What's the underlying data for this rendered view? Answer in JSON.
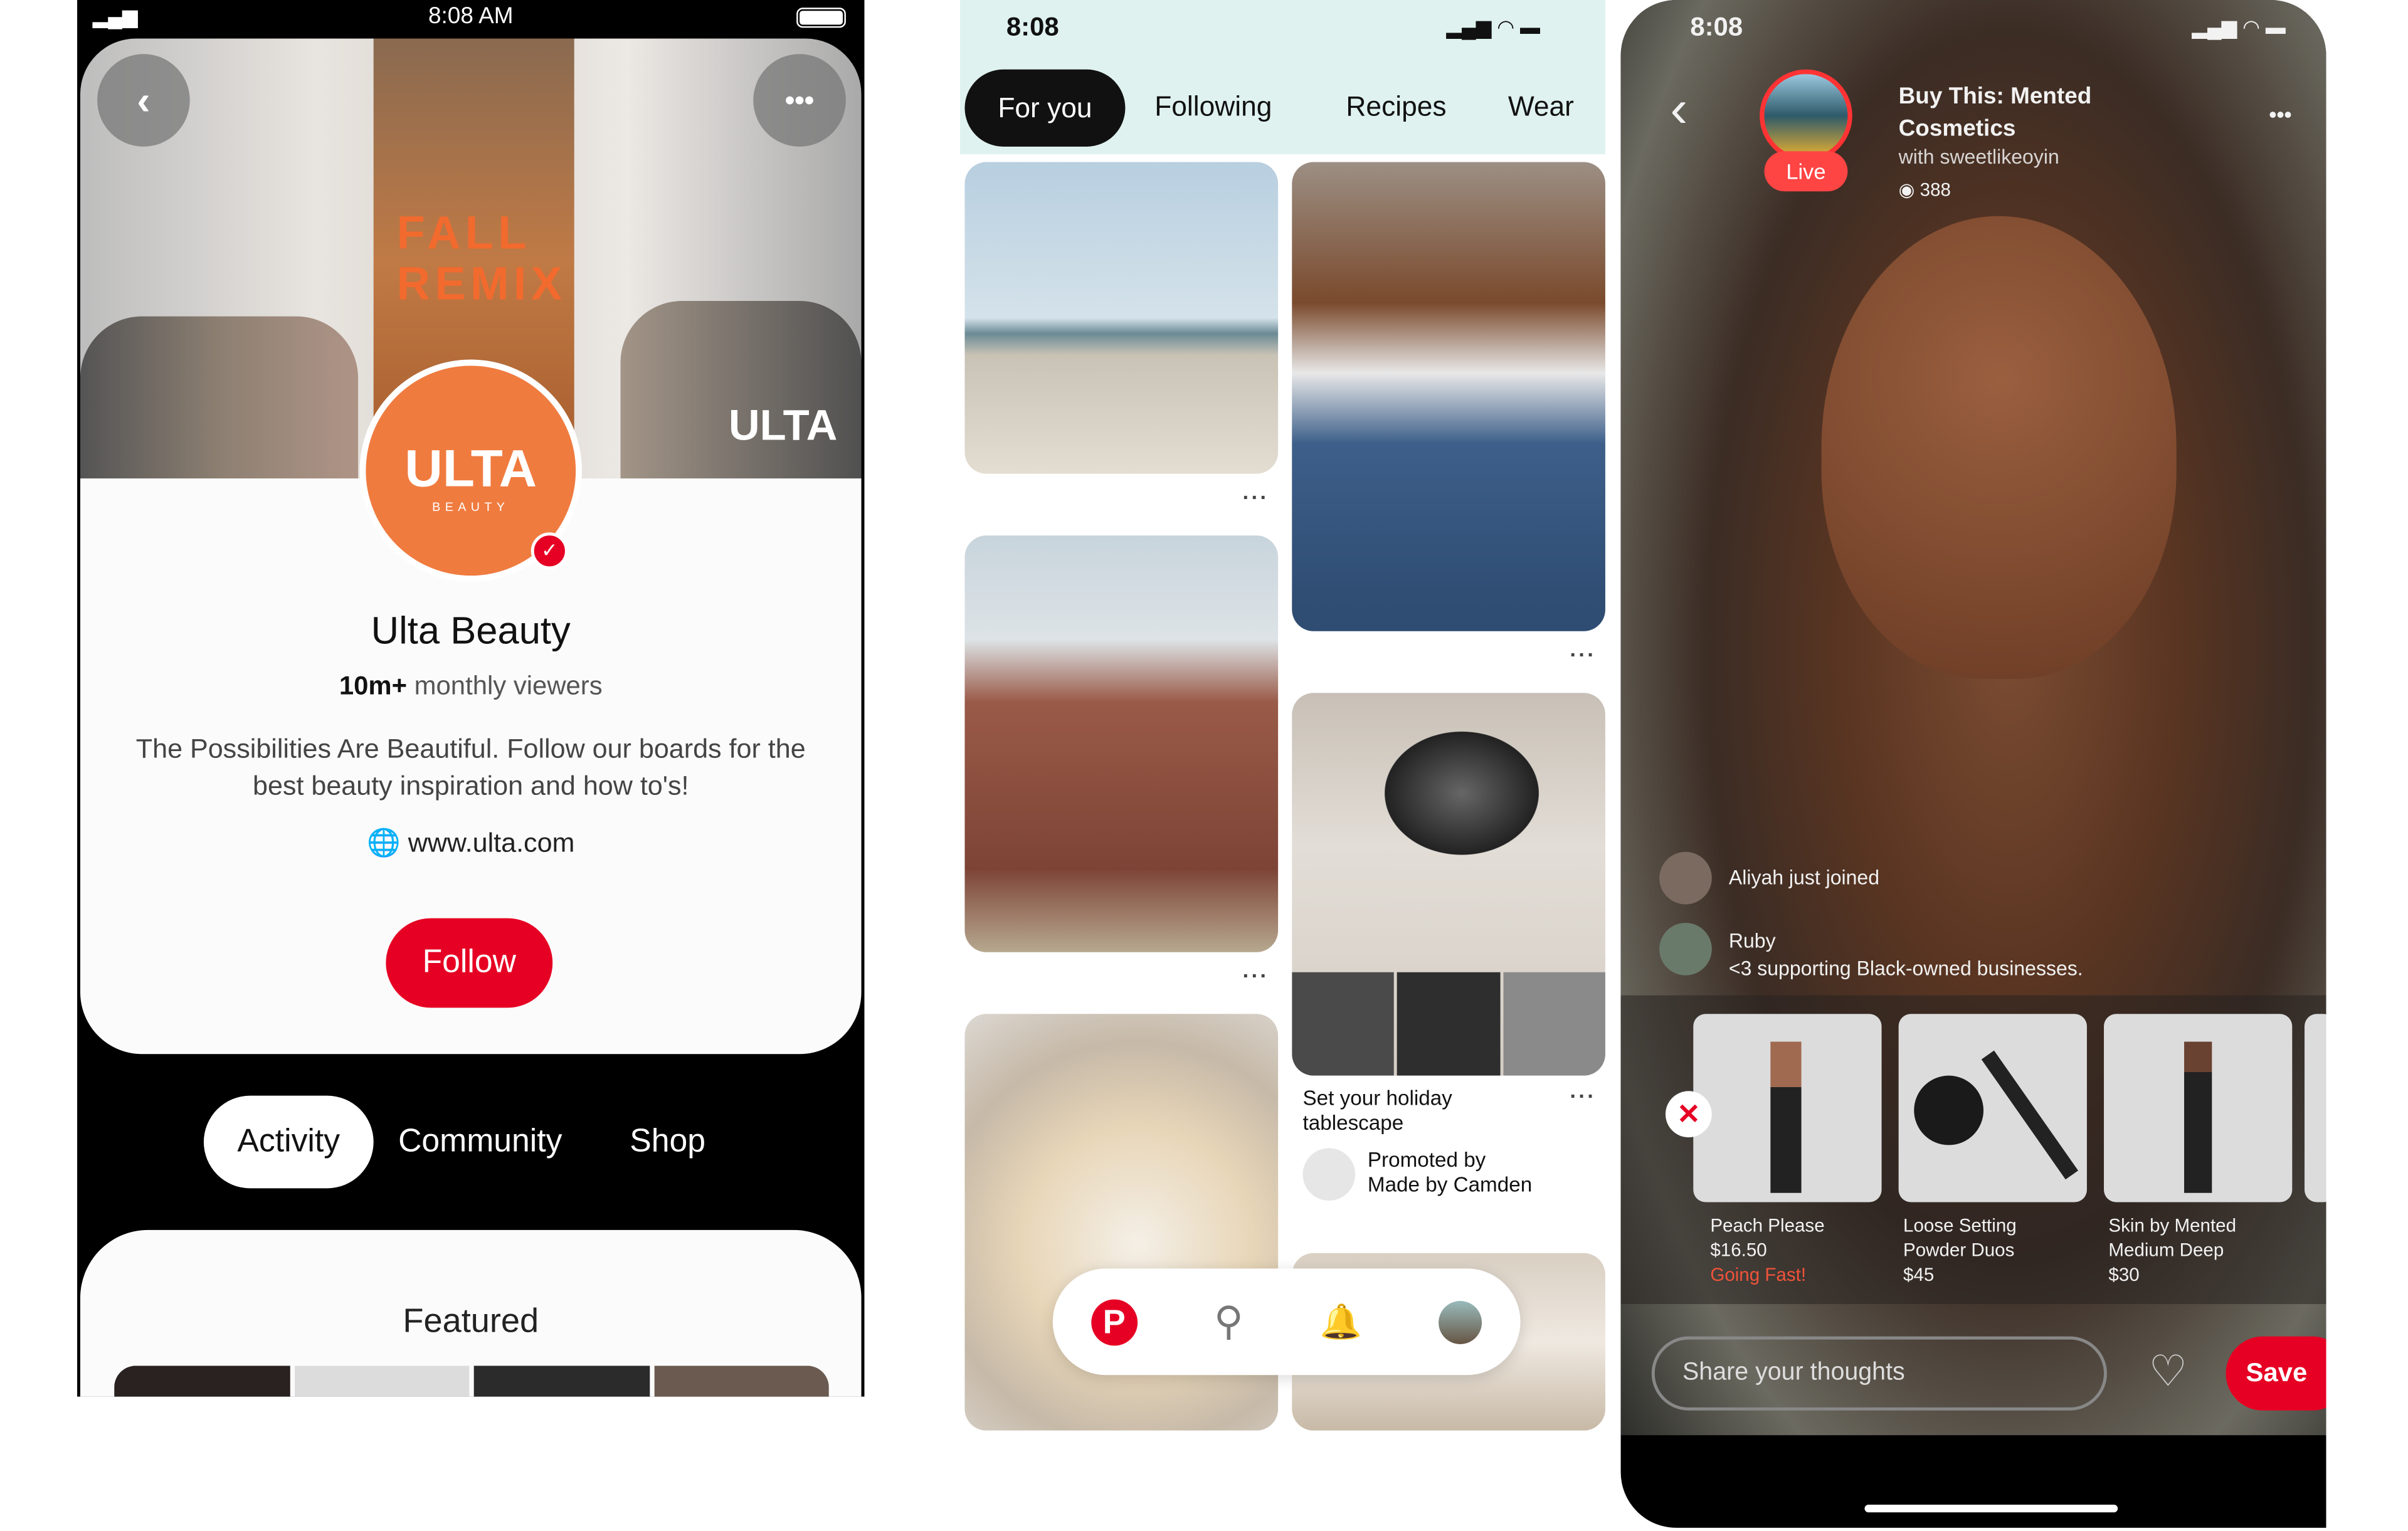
{
  "profile_screen": {
    "status_time": "8:08 AM",
    "hero_text": [
      "FALL",
      "REMIX"
    ],
    "hero_logo": "ULTA",
    "avatar_logo": "ULTA",
    "avatar_sub": "BEAUTY",
    "name": "Ulta Beauty",
    "viewers_count": "10m+",
    "viewers_label": "monthly viewers",
    "description": "The Possibilities Are Beautiful. Follow our boards for the best beauty inspiration and how to's!",
    "website": "www.ulta.com",
    "follow_label": "Follow",
    "tabs": [
      {
        "label": "Activity",
        "active": true
      },
      {
        "label": "Community"
      },
      {
        "label": "Shop"
      }
    ],
    "featured_title": "Featured",
    "accent_color": "#e60023",
    "avatar_color": "#f07b3f"
  },
  "feed_screen": {
    "status_time": "8:08",
    "tabs": [
      {
        "label": "For you",
        "active": true
      },
      {
        "label": "Following"
      },
      {
        "label": "Recipes"
      },
      {
        "label": "Wear"
      }
    ],
    "promo_pin": {
      "title": "Set your holiday tablescape",
      "promoted_label": "Promoted by",
      "advertiser": "Made by Camden"
    },
    "nav_icons": [
      "pinterest-icon",
      "search-icon",
      "bell-icon",
      "profile-avatar"
    ]
  },
  "live_screen": {
    "status_time": "8:08",
    "title": "Buy This: Mented Cosmetics",
    "host": "with sweetlikeoyin",
    "viewer_count": "388",
    "live_badge": "Live",
    "comments": [
      {
        "user": "",
        "text": "Aliyah just joined"
      },
      {
        "user": "Ruby",
        "text": "<3 supporting Black-owned businesses."
      }
    ],
    "products": [
      {
        "name": "Peach Please",
        "price": "$16.50",
        "note": "Going Fast!"
      },
      {
        "name": "Loose Setting Powder Duos",
        "price": "$45"
      },
      {
        "name": "Skin by Mented Medium Deep",
        "price": "$30"
      }
    ],
    "comment_placeholder": "Share your thoughts",
    "save_label": "Save"
  }
}
